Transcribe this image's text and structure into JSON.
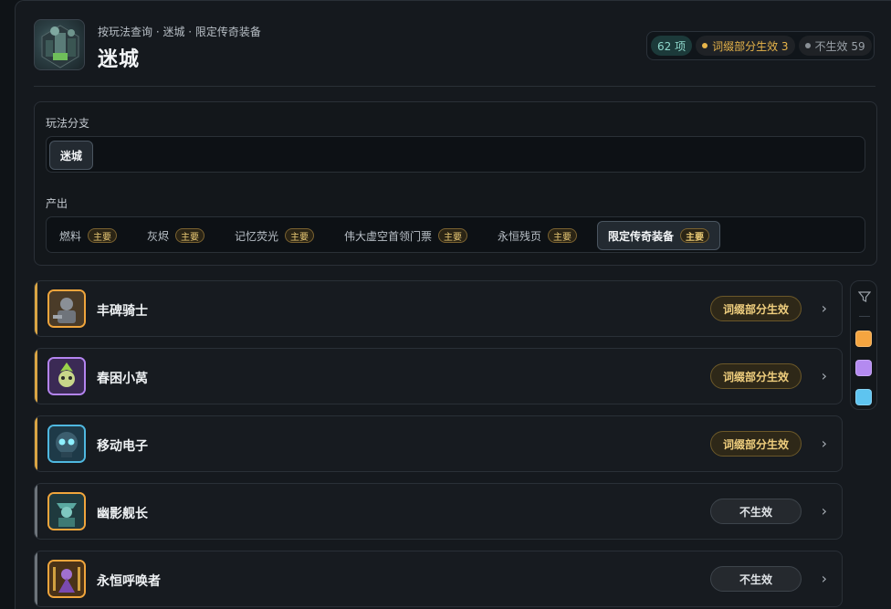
{
  "header": {
    "breadcrumb": "按玩法查询 · 迷城 · 限定传奇装备",
    "title": "迷城"
  },
  "stats": {
    "count": "62 项",
    "partial": "词缀部分生效 3",
    "none": "不生效 59",
    "partial_color": "#e8b54a",
    "none_color": "#8a9096"
  },
  "filters": {
    "branch_label": "玩法分支",
    "branch_chips": [
      {
        "label": "迷城",
        "active": true
      }
    ],
    "output_label": "产出",
    "output_chips": [
      {
        "label": "燃料",
        "tag": "主要",
        "active": false
      },
      {
        "label": "灰烬",
        "tag": "主要",
        "active": false
      },
      {
        "label": "记忆荧光",
        "tag": "主要",
        "active": false
      },
      {
        "label": "伟大虚空首领门票",
        "tag": "主要",
        "active": false
      },
      {
        "label": "永恒残页",
        "tag": "主要",
        "active": false
      },
      {
        "label": "限定传奇装备",
        "tag": "主要",
        "active": true
      }
    ]
  },
  "items": [
    {
      "name": "丰碑骑士",
      "status": "词缀部分生效",
      "kind": "partial",
      "rarity_color": "#f0a53c",
      "avatar_icon": "knight-portrait-icon"
    },
    {
      "name": "春困小莴",
      "status": "词缀部分生效",
      "kind": "partial",
      "rarity_color": "#b484f0",
      "avatar_icon": "sprout-portrait-icon"
    },
    {
      "name": "移动电子",
      "status": "词缀部分生效",
      "kind": "partial",
      "rarity_color": "#4fb8e0",
      "avatar_icon": "robot-portrait-icon"
    },
    {
      "name": "幽影舰长",
      "status": "不生效",
      "kind": "none",
      "rarity_color": "#f0a53c",
      "avatar_icon": "captain-portrait-icon"
    },
    {
      "name": "永恒呼唤者",
      "status": "不生效",
      "kind": "none",
      "rarity_color": "#f0a53c",
      "avatar_icon": "caller-portrait-icon"
    }
  ],
  "sidebar": {
    "filter_icon": "filter-icon",
    "swatches": [
      "#f5a540",
      "#b48af0",
      "#5ec4f0"
    ]
  },
  "colors": {
    "accent_partial_bar": "#d9a443",
    "accent_none_bar": "#6d747b"
  }
}
